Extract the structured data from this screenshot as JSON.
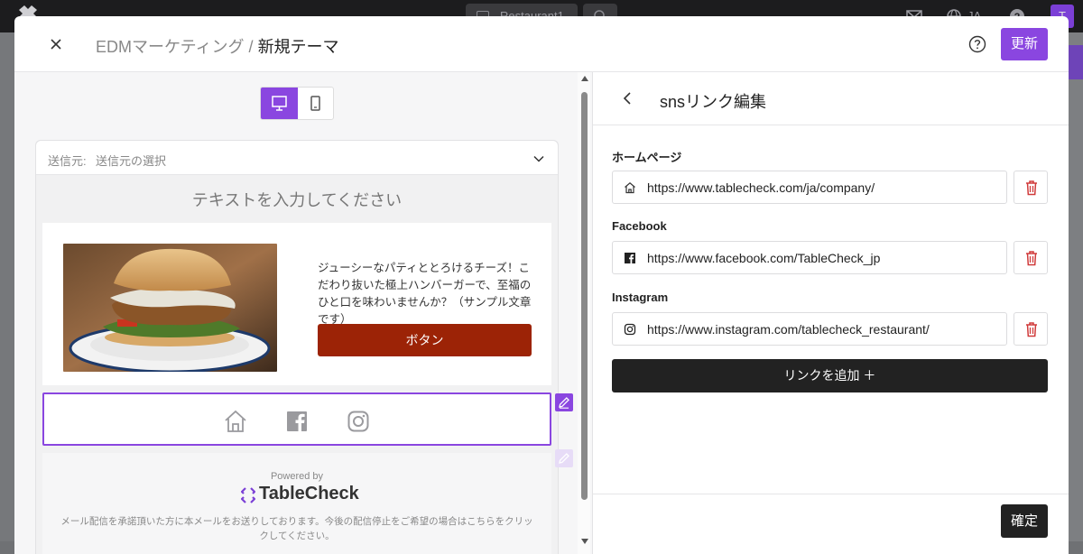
{
  "background": {
    "tab_label": "Restaurant1",
    "language": "JA",
    "avatar_initial": "T"
  },
  "modal": {
    "title_prefix": "EDMマーケティング / ",
    "title_current": "新規テーマ",
    "update_label": "更新"
  },
  "preview": {
    "sender_label": "送信元:",
    "sender_value": "送信元の選択",
    "headline": "テキストを入力してください",
    "promo_text": "ジューシーなパティととろけるチーズ！こだわり抜いた極上ハンバーガーで、至福のひと口を味わいませんか？（サンプル文章です）",
    "button_label": "ボタン",
    "powered_by": "Powered by",
    "brand": "TableCheck",
    "disclaimer": "メール配信を承諾頂いた方に本メールをお送りしております。今後の配信停止をご希望の場合はこちらをクリックしてください。"
  },
  "sns_panel": {
    "title": "snsリンク編集",
    "links": [
      {
        "label": "ホームページ",
        "url": "https://www.tablecheck.com/ja/company/",
        "icon": "home-icon"
      },
      {
        "label": "Facebook",
        "url": "https://www.facebook.com/TableCheck_jp",
        "icon": "facebook-icon"
      },
      {
        "label": "Instagram",
        "url": "https://www.instagram.com/tablecheck_restaurant/",
        "icon": "instagram-icon"
      }
    ],
    "add_link_label": "リンクを追加 ＋",
    "confirm_label": "確定"
  },
  "colors": {
    "accent": "#8a46e0",
    "cta": "#9c2306",
    "dark_button": "#222222",
    "delete": "#d03a3a"
  }
}
